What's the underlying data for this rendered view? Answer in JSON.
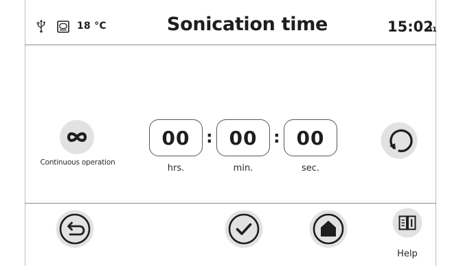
{
  "status_bar": {
    "usb_icon": "usb-icon",
    "storage_icon": "storage-icon",
    "temperature": "18 °C",
    "title": "Sonication time",
    "time": "15:02",
    "time_suffix": "21"
  },
  "continuous": {
    "icon": "infinity-icon",
    "symbol": "∞",
    "label": "Continuous operation"
  },
  "timer": {
    "hours": "00",
    "minutes": "00",
    "seconds": "00",
    "separator": ":",
    "hours_label": "hrs.",
    "minutes_label": "min.",
    "seconds_label": "sec."
  },
  "reset": {
    "icon": "reset-icon"
  },
  "bottom_bar": {
    "back_icon": "back-arrow-icon",
    "confirm_icon": "check-icon",
    "home_icon": "home-icon",
    "help_icon": "book-icon",
    "help_label": "Help"
  },
  "colors": {
    "icon_stroke": "#1e1e1e",
    "button_fill": "#e2e2e2",
    "divider": "#8c8c8c"
  }
}
